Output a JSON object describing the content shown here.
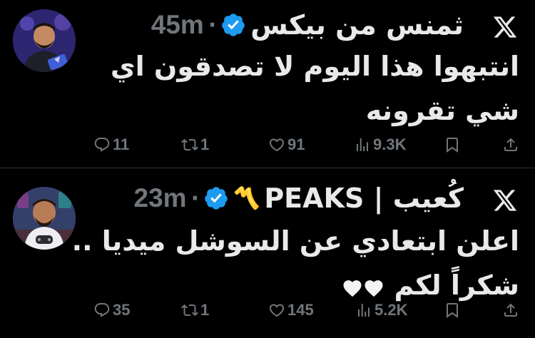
{
  "tweets": [
    {
      "display_name": "ثمنس من بيكس",
      "name_mark": "",
      "time": "45m",
      "text_lines": [
        "انتبهوا هذا اليوم لا تصدقون اي",
        "شي تقرونه"
      ],
      "replies": "11",
      "reposts": "1",
      "likes": "91",
      "views": "9.3K"
    },
    {
      "display_name": "PEAKS | كُعيب",
      "name_mark": "〽️",
      "time": "23m",
      "text_lines": [
        "اعلن ابتعادي عن السوشل ميديا ..",
        "شكراً لكم"
      ],
      "emoji": "🤍🤍",
      "replies": "35",
      "reposts": "1",
      "likes": "145",
      "views": "5.2K"
    }
  ],
  "icons": {
    "platform": "x-logo-icon",
    "verified": "verified-badge-icon",
    "reply": "reply-icon",
    "repost": "repost-icon",
    "like": "like-icon",
    "views": "views-icon",
    "bookmark": "bookmark-icon",
    "share": "share-icon"
  },
  "colors": {
    "background": "#000000",
    "text": "#e7e9ea",
    "muted": "#71767b",
    "verified": "#1d9bf0",
    "divider": "#2f3336"
  }
}
